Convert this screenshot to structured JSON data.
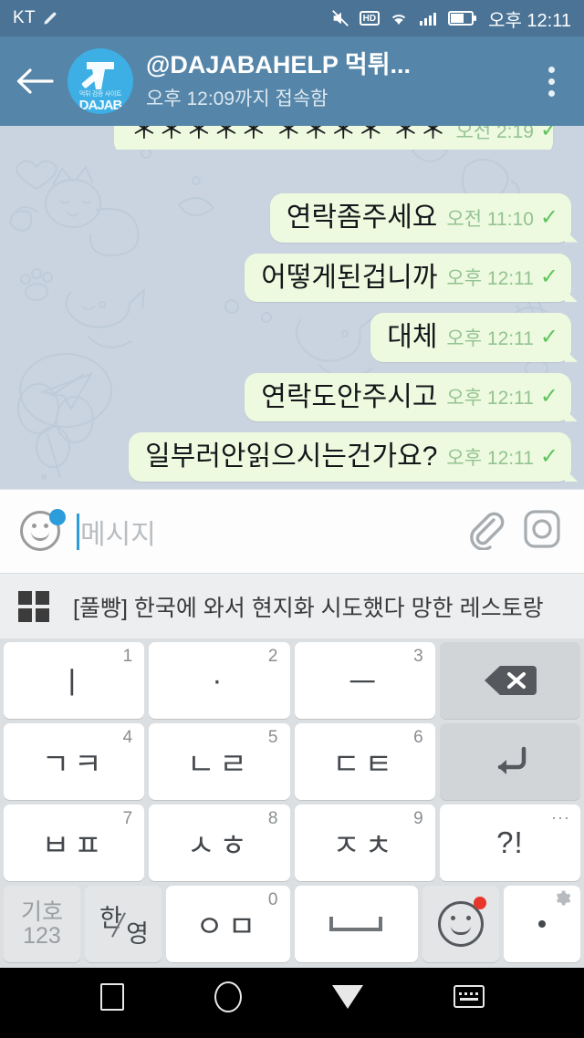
{
  "status_bar": {
    "carrier": "KT",
    "time": "오후 12:11",
    "icons": [
      "pen-icon",
      "mute-icon",
      "hd-icon",
      "wifi-icon",
      "signal-icon",
      "battery-icon"
    ],
    "hd_label": "HD",
    "background_color": "#4a7396"
  },
  "header": {
    "back_icon": "back-arrow-icon",
    "avatar": {
      "letter": "D",
      "sub_label": "DAJAB",
      "tiny_label": "먹튀 검증 사이트",
      "color": "#3dafe4"
    },
    "title": "@DAJABAHELP 먹튀...",
    "subtitle": "오후 12:09까지 접속함",
    "menu_icon": "kebab-menu-icon",
    "background_color": "#5585a8"
  },
  "chat": {
    "background_color": "#c9d4e0",
    "bubble_color": "#eefadf",
    "messages": [
      {
        "text": "",
        "time": "오전 2:19",
        "status": "sent",
        "clipped": true
      },
      {
        "text": "연락좀주세요",
        "time": "오전 11:10",
        "status": "sent",
        "clipped": false
      },
      {
        "text": "어떻게된겁니까",
        "time": "오후 12:11",
        "status": "sent",
        "clipped": false
      },
      {
        "text": "대체",
        "time": "오후 12:11",
        "status": "sent",
        "clipped": false
      },
      {
        "text": "연락도안주시고",
        "time": "오후 12:11",
        "status": "sent",
        "clipped": false
      },
      {
        "text": "일부러안읽으시는건가요?",
        "time": "오후 12:11",
        "status": "sent",
        "clipped": false
      }
    ],
    "check_glyph": "✓"
  },
  "input_bar": {
    "emoji_icon": "smiley-icon",
    "badge": "blue-dot-badge",
    "placeholder": "메시지",
    "value": "",
    "attach_icon": "paperclip-icon",
    "camera_icon": "camera-icon"
  },
  "suggestion_bar": {
    "grid_icon": "grid-apps-icon",
    "text": "[풀빵] 한국에 와서 현지화 시도했다 망한 레스토랑"
  },
  "keyboard": {
    "background_color": "#dcdfe1",
    "rows": [
      [
        {
          "main": "ㅣ",
          "num": "1",
          "type": "char"
        },
        {
          "main": "·",
          "num": "2",
          "type": "char"
        },
        {
          "main": "ㅡ",
          "num": "3",
          "type": "char"
        },
        {
          "main": "",
          "num": "",
          "type": "backspace",
          "icon": "backspace-icon"
        }
      ],
      [
        {
          "main": "ㄱㅋ",
          "num": "4",
          "type": "char"
        },
        {
          "main": "ㄴㄹ",
          "num": "5",
          "type": "char"
        },
        {
          "main": "ㄷㅌ",
          "num": "6",
          "type": "char"
        },
        {
          "main": "",
          "num": "",
          "type": "enter",
          "icon": "enter-icon"
        }
      ],
      [
        {
          "main": "ㅂㅍ",
          "num": "7",
          "type": "char"
        },
        {
          "main": "ㅅㅎ",
          "num": "8",
          "type": "char"
        },
        {
          "main": "ㅈㅊ",
          "num": "9",
          "type": "char"
        },
        {
          "main": "?!",
          "num": "···",
          "type": "symbol"
        }
      ]
    ],
    "bottom_row": {
      "symbol_key": {
        "line1": "기호",
        "line2": "123"
      },
      "lang_key": {
        "han": "한",
        "yeong": "영"
      },
      "oh_key": {
        "main": "ㅇㅁ",
        "num": "0"
      },
      "space_key": {
        "label": ""
      },
      "emoji_key": {
        "icon": "emoji-icon",
        "badge": "red-dot-badge"
      },
      "period_key": {
        "main": ".",
        "gear": "gear-icon"
      }
    }
  },
  "nav_bar": {
    "items": [
      {
        "name": "recents",
        "icon": "square-icon"
      },
      {
        "name": "home",
        "icon": "circle-icon"
      },
      {
        "name": "back",
        "icon": "triangle-down-icon"
      },
      {
        "name": "hide-keyboard",
        "icon": "keyboard-icon"
      }
    ]
  }
}
